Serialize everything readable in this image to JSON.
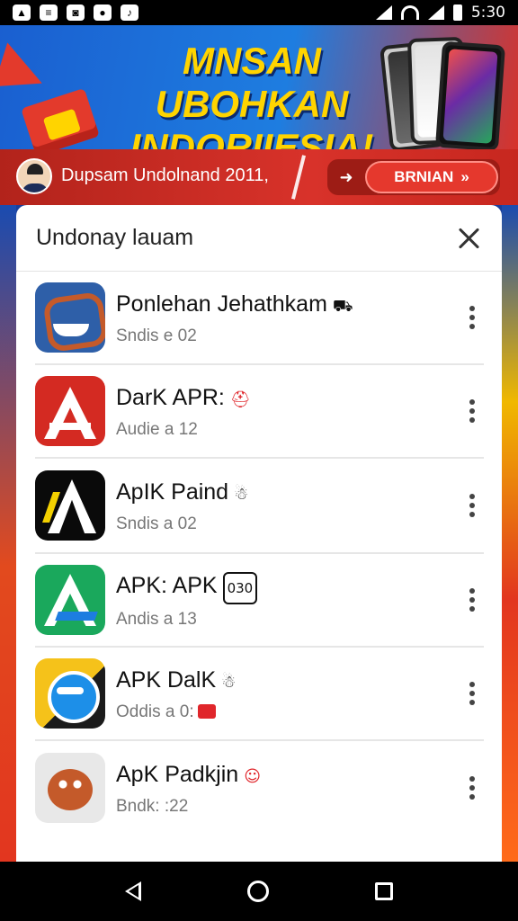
{
  "status_bar": {
    "left_icons": [
      "app-notification-icon",
      "news-icon",
      "camera-icon",
      "media-icon",
      "music-icon"
    ],
    "time": "5:30"
  },
  "banner": {
    "title": "MNSAN UBOHKAN INDORIIESIA!"
  },
  "strip": {
    "text": "Dupsam Undolnand 2011,",
    "button_label": "BRNIAN"
  },
  "dialog": {
    "title": "Undonay lauam",
    "items": [
      {
        "name": "Ponlehan Jehathkam",
        "badge": "⛟",
        "sub": "Sndis e 02",
        "icon": "ponlehan-app-icon"
      },
      {
        "name": "DarK APR:",
        "badge": "⛑",
        "sub": "Audie a 12",
        "icon": "dark-apr-app-icon"
      },
      {
        "name": "ApIK Paind",
        "badge": "☃",
        "sub": "Sndis a 02",
        "icon": "apik-paind-app-icon"
      },
      {
        "name": "APK: APK",
        "badge": "030",
        "sub": "Andis a 13",
        "icon": "apk-apk-app-icon"
      },
      {
        "name": "APK DalK",
        "badge": "☃",
        "sub": "Oddis a 0:",
        "icon": "apk-dalk-app-icon"
      },
      {
        "name": "ApK Padkjin",
        "badge": "☺",
        "sub": "Bndk: :22",
        "icon": "apk-padkjin-app-icon"
      }
    ]
  },
  "colors": {
    "banner_title": "#ffd400",
    "strip_red": "#d8322a",
    "dialog_bg": "#ffffff"
  }
}
